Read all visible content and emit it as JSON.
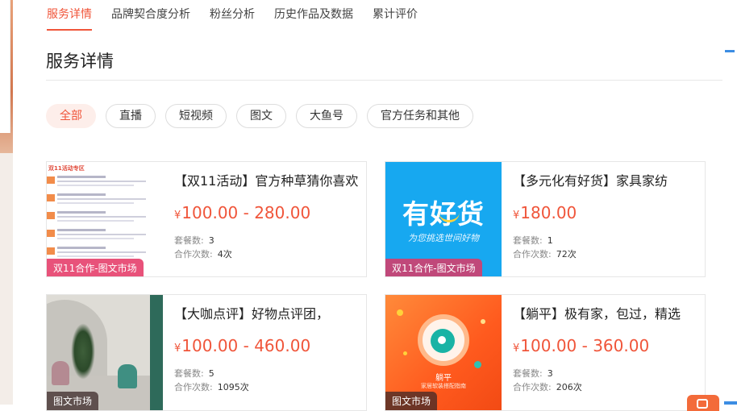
{
  "tabs": [
    {
      "label": "服务详情",
      "active": true
    },
    {
      "label": "品牌契合度分析",
      "active": false
    },
    {
      "label": "粉丝分析",
      "active": false
    },
    {
      "label": "历史作品及数据",
      "active": false
    },
    {
      "label": "累计评价",
      "active": false
    }
  ],
  "section_title": "服务详情",
  "filters": [
    {
      "label": "全部",
      "active": true
    },
    {
      "label": "直播",
      "active": false
    },
    {
      "label": "短视频",
      "active": false
    },
    {
      "label": "图文",
      "active": false
    },
    {
      "label": "大鱼号",
      "active": false
    },
    {
      "label": "官方任务和其他",
      "active": false
    }
  ],
  "meta_labels": {
    "packages": "套餐数:",
    "collaborations": "合作次数:"
  },
  "cards": [
    {
      "title": "【双11活动】官方种草猜你喜欢",
      "currency": "¥",
      "price": "100.00 - 280.00",
      "packages": "3",
      "collaborations": "4次",
      "tag": "双11合作-图文市场",
      "thumb_header": "双11活动专区"
    },
    {
      "title": "【多元化有好货】家具家纺",
      "currency": "¥",
      "price": "180.00",
      "packages": "1",
      "collaborations": "72次",
      "tag": "双11合作-图文市场",
      "thumb_big": "有好货",
      "thumb_sub": "为您挑选世间好物"
    },
    {
      "title": "【大咖点评】好物点评团，",
      "currency": "¥",
      "price": "100.00 - 460.00",
      "packages": "5",
      "collaborations": "1095次",
      "tag": "图文市场"
    },
    {
      "title": "【躺平】极有家，包过，精选",
      "currency": "¥",
      "price": "100.00 - 360.00",
      "packages": "3",
      "collaborations": "206次",
      "tag": "图文市场",
      "thumb_brand": "躺平",
      "thumb_slogan": "家居软装搭配指南"
    }
  ],
  "colors": {
    "accent": "#f0553a",
    "tag_pink": "#e8527a",
    "blue_thumb": "#17a8f0"
  }
}
